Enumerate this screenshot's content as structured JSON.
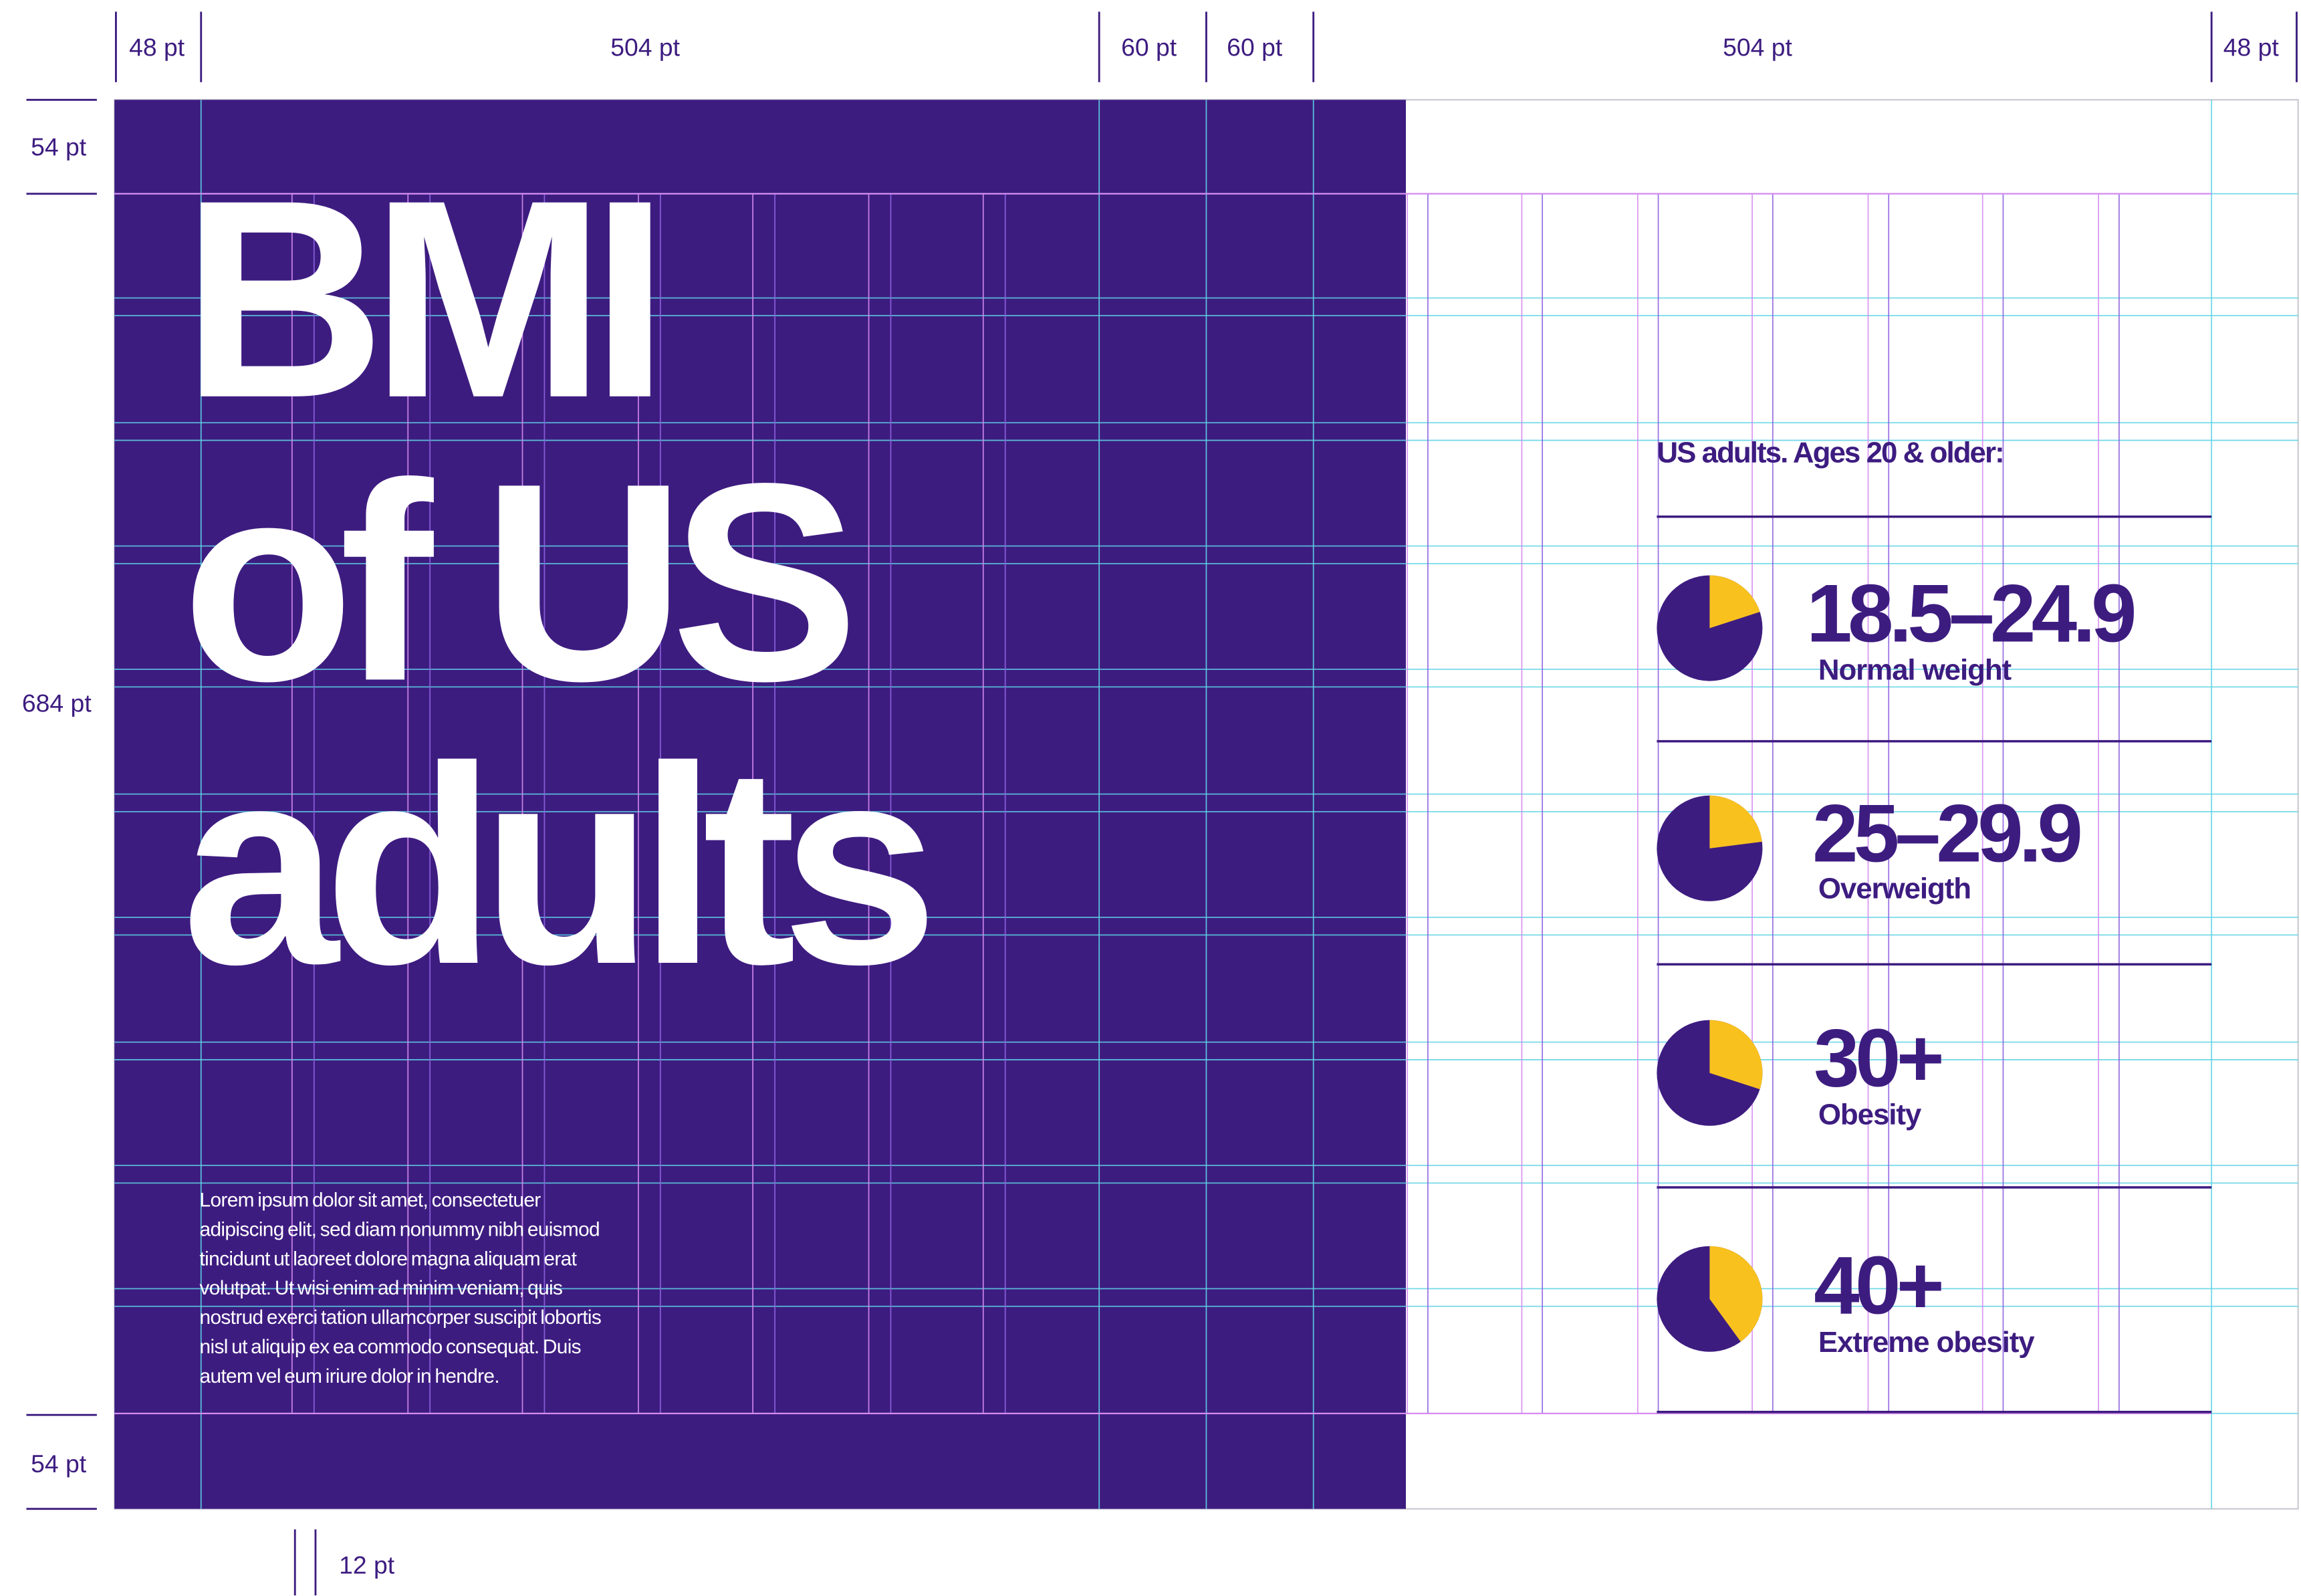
{
  "colors": {
    "primary": "#3d1c80",
    "accent": "#f8c11e",
    "background": "#ffffff",
    "guide_cyan": "#5fd3e6",
    "guide_magenta": "#d68cf0",
    "guide_violet": "#8e63e0"
  },
  "dimensions": {
    "top": [
      "48 pt",
      "504 pt",
      "60 pt",
      "60 pt",
      "504 pt",
      "48 pt"
    ],
    "left": [
      "54 pt",
      "684 pt",
      "54 pt"
    ],
    "bottom": "12 pt"
  },
  "poster": {
    "title_lines": [
      "BMI",
      "of US",
      "adults"
    ],
    "body": "Lorem ipsum dolor sit amet, consectetuer adipiscing elit, sed diam nonummy nibh euismod tincidunt ut laoreet dolore magna aliquam erat volutpat. Ut wisi enim ad minim veniam, quis nostrud exerci tation ullamcorper suscipit lobortis nisl ut aliquip ex ea commodo consequat. Duis autem vel eum iriure dolor in hendre.",
    "heading": "US adults. Ages 20 & older:",
    "categories": [
      {
        "range": "18.5–24.9",
        "label": "Normal weight",
        "share": 0.2
      },
      {
        "range": "25–29.9",
        "label": "Overweigth",
        "share": 0.23
      },
      {
        "range": "30+",
        "label": "Obesity",
        "share": 0.3
      },
      {
        "range": "40+",
        "label": "Extreme obesity",
        "share": 0.4
      }
    ]
  }
}
